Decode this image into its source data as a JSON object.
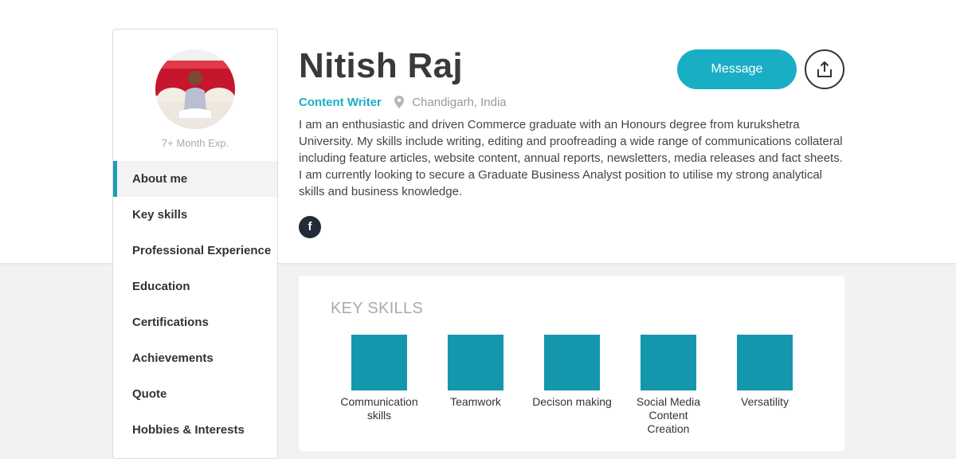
{
  "profile": {
    "name": "Nitish Raj",
    "role": "Content Writer",
    "location": "Chandigarh, India",
    "experience": "7+ Month Exp.",
    "bio": "I am an enthusiastic and driven Commerce graduate with an Honours degree from kurukshetra University. My skills include writing, editing and proofreading a wide range of communications collateral including feature articles, website content, annual reports, newsletters, media releases and fact sheets. I am currently looking to secure a Graduate Business Analyst position to utilise my strong analytical skills and business knowledge.",
    "social": {
      "facebook_label": "f"
    }
  },
  "actions": {
    "message_label": "Message",
    "share_icon": "share-icon"
  },
  "nav": {
    "items": [
      {
        "label": "About me",
        "active": true
      },
      {
        "label": "Key skills"
      },
      {
        "label": "Professional Experience"
      },
      {
        "label": "Education"
      },
      {
        "label": "Certifications"
      },
      {
        "label": "Achievements"
      },
      {
        "label": "Quote"
      },
      {
        "label": "Hobbies & Interests"
      }
    ]
  },
  "skills": {
    "title": "KEY SKILLS",
    "items": [
      {
        "label": "Communication skills"
      },
      {
        "label": "Teamwork"
      },
      {
        "label": "Decison making"
      },
      {
        "label": "Social Media Content Creation"
      },
      {
        "label": "Versatility"
      }
    ]
  },
  "colors": {
    "accent": "#1aaec5",
    "tile": "#1497ad",
    "facebook_bg": "#222b37"
  }
}
